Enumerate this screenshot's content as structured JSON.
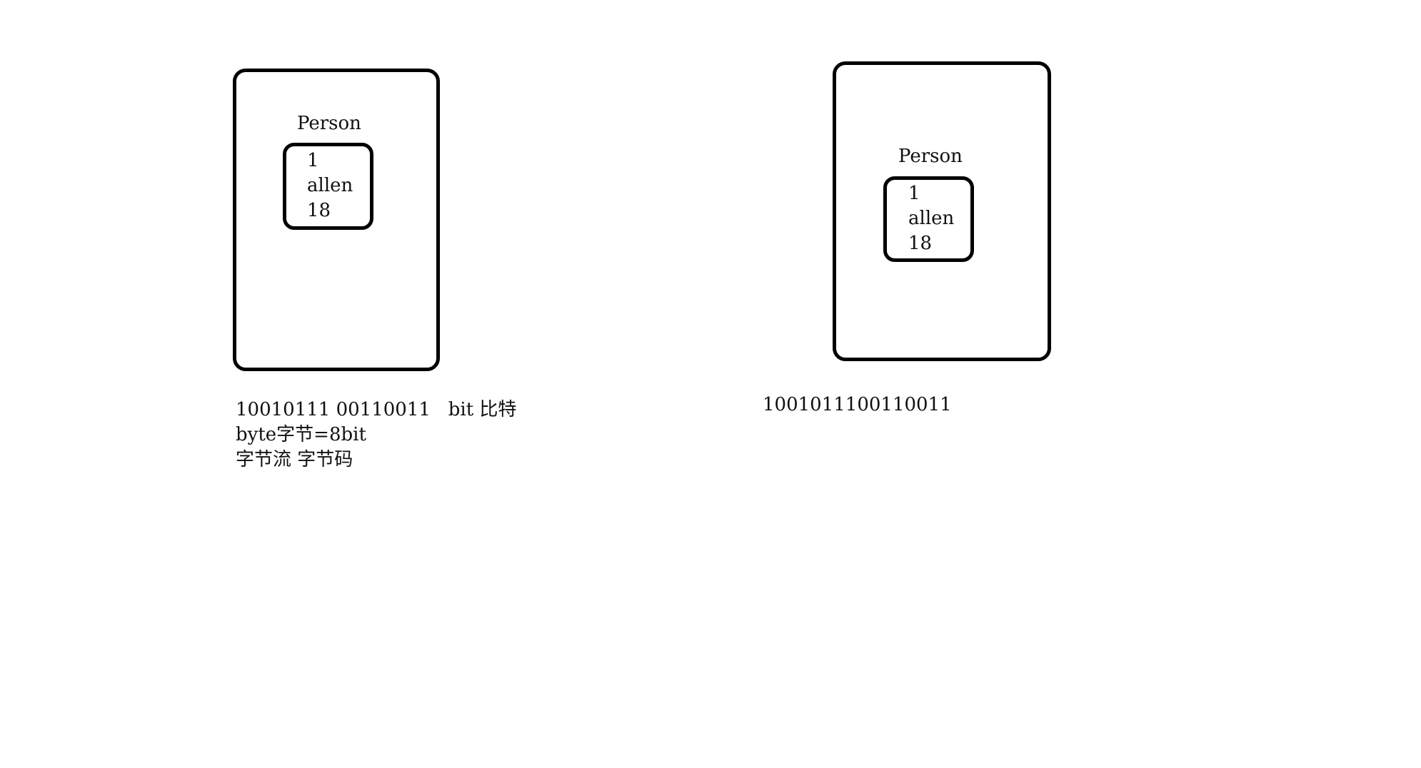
{
  "left_object": {
    "class_name": "Person",
    "fields": [
      "1",
      "allen",
      "18"
    ]
  },
  "right_object": {
    "class_name": "Person",
    "fields": [
      "1",
      "allen",
      "18"
    ]
  },
  "notes": {
    "left_lines": [
      "10010111 00110011   bit 比特",
      "byte字节=8bit",
      "字节流 字节码"
    ],
    "right_binary": "1001011100110011"
  }
}
